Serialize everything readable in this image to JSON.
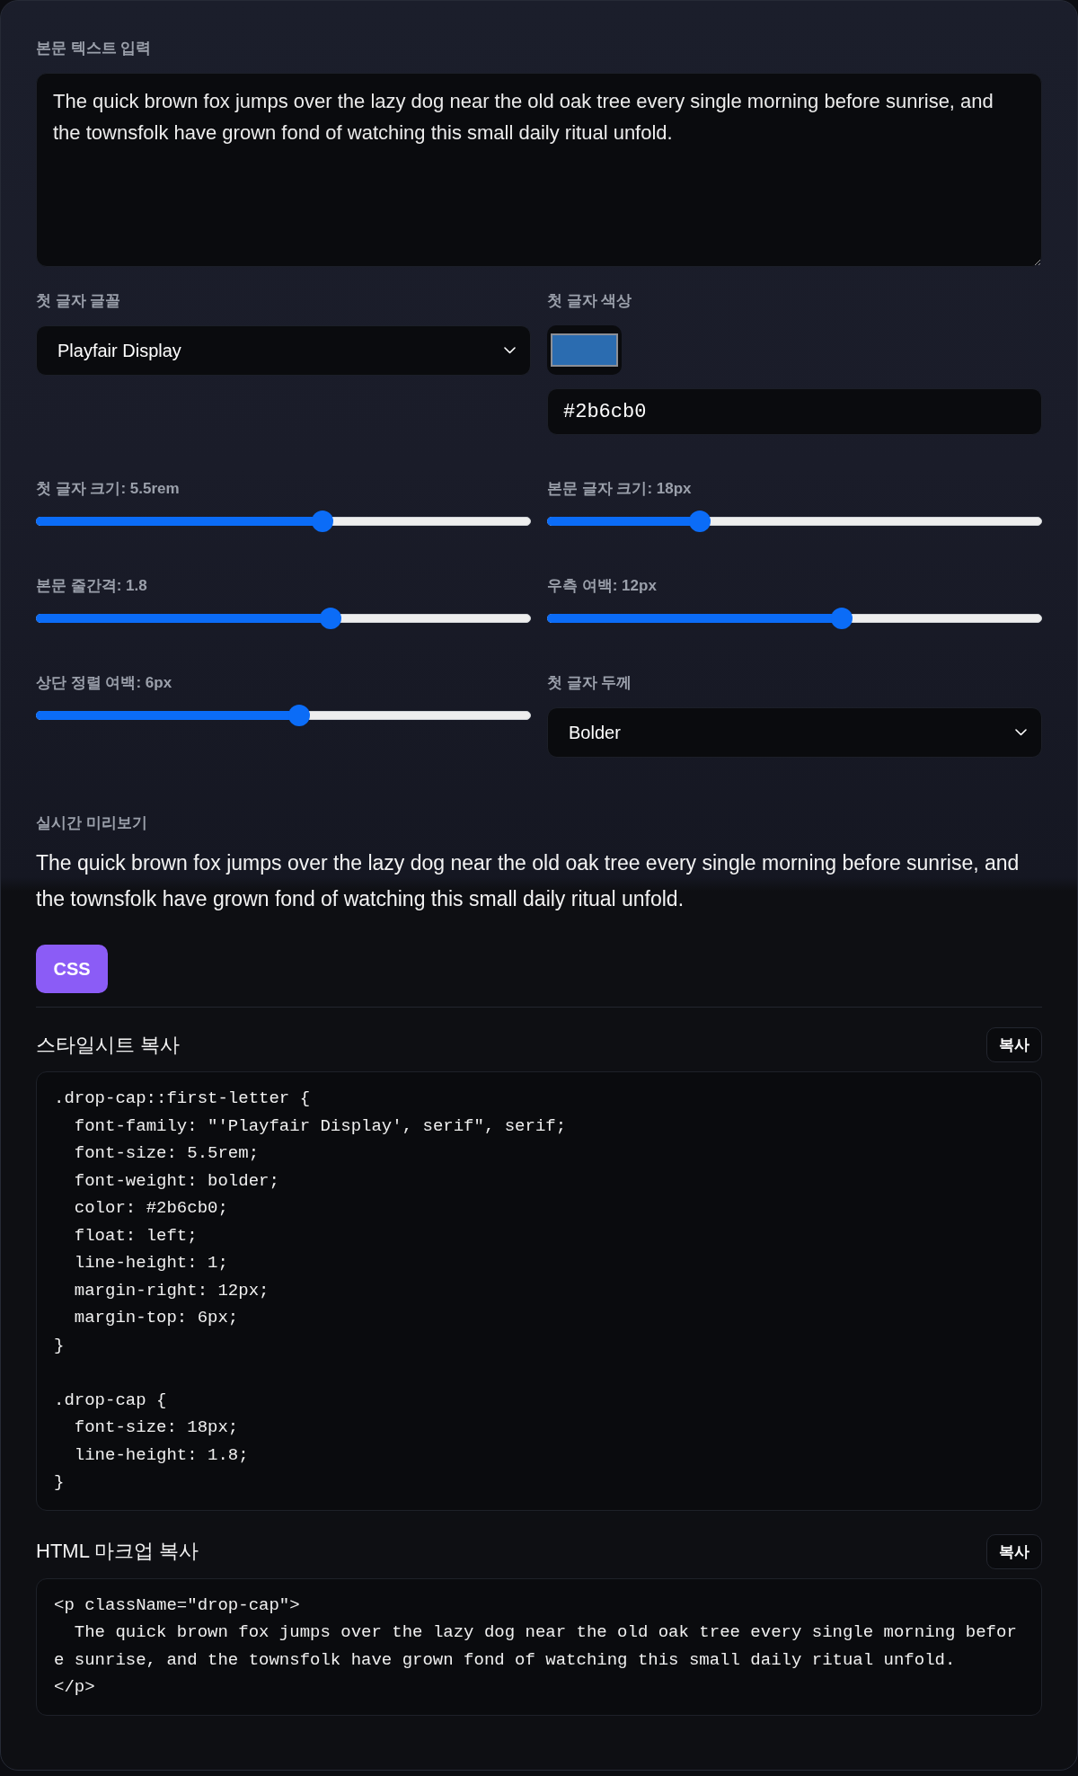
{
  "text_input": {
    "label": "본문 텍스트 입력",
    "value": "The quick brown fox jumps over the lazy dog near the old oak tree every single morning before sunrise, and the townsfolk have grown fond of watching this small daily ritual unfold."
  },
  "controls": [
    {
      "kind": "select",
      "label": "첫 글자 글꼴",
      "value": "Playfair Display"
    },
    {
      "kind": "color",
      "label": "첫 글자 색상",
      "color": "#2b6cb0",
      "value": "#2b6cb0"
    },
    {
      "kind": "slider",
      "label": "첫 글자 크기: 5.5rem",
      "level": 0.583
    },
    {
      "kind": "slider",
      "label": "본문 글자 크기: 18px",
      "level": 0.3
    },
    {
      "kind": "slider",
      "label": "본문 줄간격: 1.8",
      "level": 0.6
    },
    {
      "kind": "slider",
      "label": "우측 여백: 12px",
      "level": 0.6
    },
    {
      "kind": "slider",
      "label": "상단 정렬 여백: 6px",
      "level": 0.533
    },
    {
      "kind": "select",
      "label": "첫 글자 두께",
      "value": "Bolder"
    }
  ],
  "preview": {
    "label": "실시간 미리보기",
    "text": "The quick brown fox jumps over the lazy dog near the old oak tree every single morning before sunrise, and the townsfolk have grown fond of watching this small daily ritual unfold."
  },
  "tabs": [
    {
      "label": "CSS",
      "selected": true
    }
  ],
  "sections": [
    {
      "title": "스타일시트 복사",
      "button": "복사",
      "code": ".drop-cap::first-letter {\n  font-family: \"'Playfair Display', serif\", serif;\n  font-size: 5.5rem;\n  font-weight: bolder;\n  color: #2b6cb0;\n  float: left;\n  line-height: 1;\n  margin-right: 12px;\n  margin-top: 6px;\n}\n\n.drop-cap {\n  font-size: 18px;\n  line-height: 1.8;\n}"
    },
    {
      "title": "HTML 마크업 복사",
      "button": "복사",
      "code": "<p className=\"drop-cap\">\n  The quick brown fox jumps over the lazy dog near the old oak tree every single morning before sunrise, and the townsfolk have grown fond of watching this small daily ritual unfold.\n</p>"
    }
  ]
}
